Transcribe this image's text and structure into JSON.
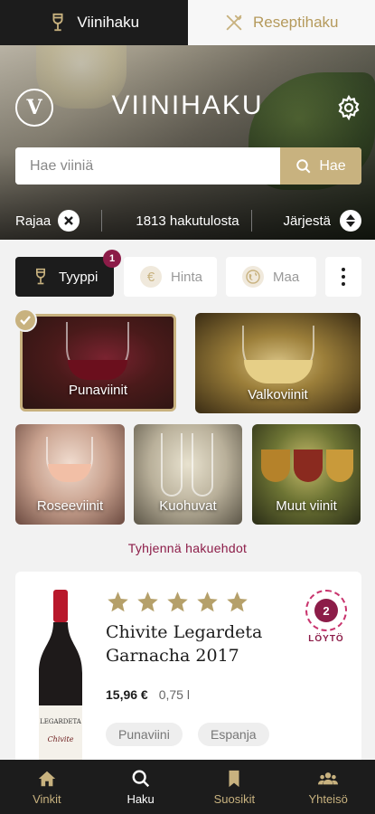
{
  "top_tabs": [
    {
      "label": "Viinihaku",
      "icon": "wine-glass-icon",
      "active": true
    },
    {
      "label": "Reseptihaku",
      "icon": "fork-knife-icon",
      "active": false
    }
  ],
  "header": {
    "logo_letter": "V",
    "title": "VIINIHAKU"
  },
  "search": {
    "placeholder": "Hae viiniä",
    "button_label": "Hae"
  },
  "filter_bar": {
    "refine_label": "Rajaa",
    "result_count": "1813 hakutulosta",
    "sort_label": "Järjestä"
  },
  "filter_chips": [
    {
      "label": "Tyyppi",
      "badge": "1",
      "active": true
    },
    {
      "label": "Hinta",
      "icon_glyph": "€",
      "active": false
    },
    {
      "label": "Maa",
      "active": false
    }
  ],
  "categories": [
    {
      "label": "Punaviinit",
      "selected": true
    },
    {
      "label": "Valkoviinit",
      "selected": false
    },
    {
      "label": "Roseeviinit",
      "selected": false
    },
    {
      "label": "Kuohuvat",
      "selected": false
    },
    {
      "label": "Muut viinit",
      "selected": false
    }
  ],
  "clear_filters_label": "Tyhjennä hakuehdot",
  "product": {
    "rating": 5,
    "badge_number": "2",
    "badge_label": "LÖYTÖ",
    "name": "Chivite Legardeta Garnacha 2017",
    "price": "15,96 €",
    "volume": "0,75 l",
    "tags": [
      "Punaviini",
      "Espanja"
    ],
    "bottle_label": "LEGARDETA",
    "bottle_script": "Chivite"
  },
  "bottom_nav": [
    {
      "label": "Vinkit",
      "icon": "home-icon",
      "active": false
    },
    {
      "label": "Haku",
      "icon": "search-icon",
      "active": true
    },
    {
      "label": "Suosikit",
      "icon": "bookmark-icon",
      "active": false
    },
    {
      "label": "Yhteisö",
      "icon": "community-icon",
      "active": false
    }
  ],
  "colors": {
    "gold": "#c8b27f",
    "dark": "#1c1c1c",
    "wine": "#8c1c48"
  }
}
